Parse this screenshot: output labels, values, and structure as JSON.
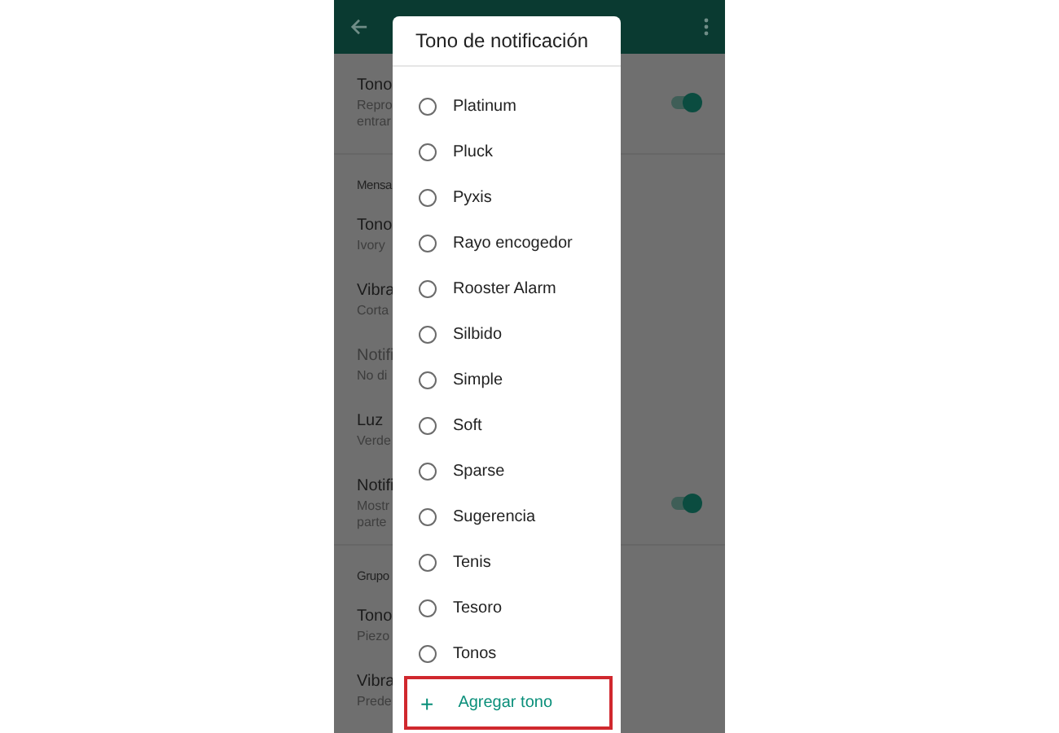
{
  "settings": [
    {
      "kind": "switch",
      "title": "Tono",
      "subtitle": [
        "Repro",
        "entrar"
      ],
      "disabled": false,
      "on": true
    },
    {
      "kind": "section",
      "title": "Mensa"
    },
    {
      "kind": "setting",
      "title": "Tono",
      "subtitle": [
        "Ivory"
      ],
      "disabled": false
    },
    {
      "kind": "setting",
      "title": "Vibra",
      "subtitle": [
        "Corta"
      ],
      "disabled": false
    },
    {
      "kind": "setting",
      "title": "Notifi",
      "subtitle": [
        "No di"
      ],
      "disabled": true
    },
    {
      "kind": "setting",
      "title": "Luz",
      "subtitle": [
        "Verde"
      ],
      "disabled": false
    },
    {
      "kind": "switch",
      "title": "Notifi",
      "subtitle": [
        "Mostr",
        "parte"
      ],
      "disabled": false,
      "on": true
    },
    {
      "kind": "section",
      "title": "Grupo"
    },
    {
      "kind": "setting",
      "title": "Tono",
      "subtitle": [
        "Piezo"
      ],
      "disabled": false
    },
    {
      "kind": "setting",
      "title": "Vibra",
      "subtitle": [
        "Prede"
      ],
      "disabled": false
    }
  ],
  "dialog": {
    "title": "Tono de notificación",
    "options": [
      {
        "label": "Platinum",
        "selected": false
      },
      {
        "label": "Pluck",
        "selected": false
      },
      {
        "label": "Pyxis",
        "selected": false
      },
      {
        "label": "Rayo encogedor",
        "selected": false
      },
      {
        "label": "Rooster Alarm",
        "selected": false
      },
      {
        "label": "Silbido",
        "selected": false
      },
      {
        "label": "Simple",
        "selected": false
      },
      {
        "label": "Soft",
        "selected": false
      },
      {
        "label": "Sparse",
        "selected": false
      },
      {
        "label": "Sugerencia",
        "selected": false
      },
      {
        "label": "Tenis",
        "selected": false
      },
      {
        "label": "Tesoro",
        "selected": false
      },
      {
        "label": "Tonos",
        "selected": false
      }
    ],
    "add_button": {
      "icon": "+",
      "label": "Agregar tono",
      "highlighted": true
    }
  }
}
